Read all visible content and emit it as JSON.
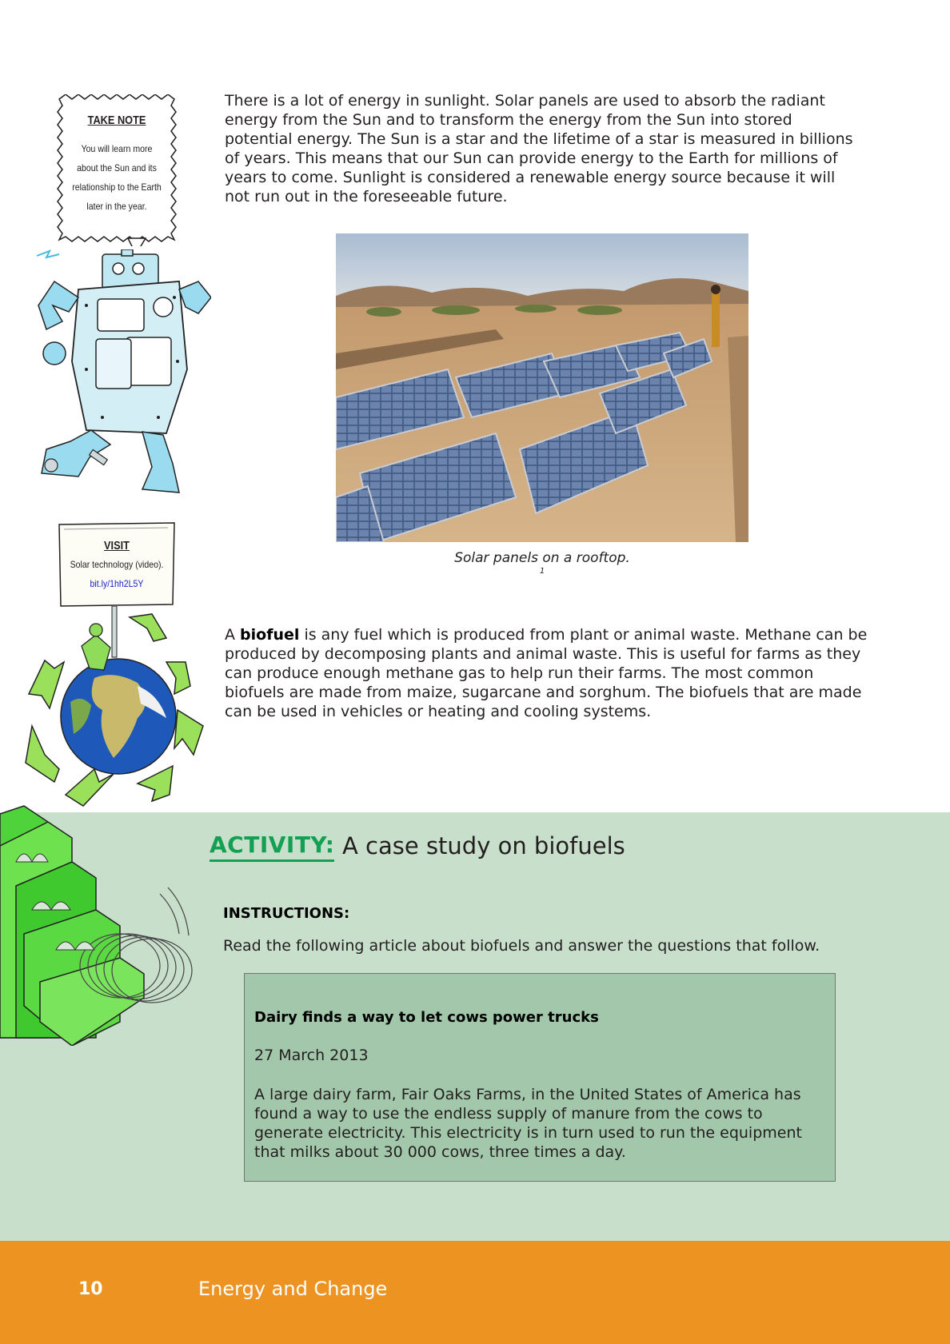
{
  "paragraphs": {
    "solar": "There is a lot of energy in sunlight. Solar panels are used to absorb the radiant energy from the Sun and to transform the energy from the Sun into stored potential energy. The Sun is a star and the lifetime of a star is measured in billions of years. This means that our Sun can provide energy to the Earth for millions of years to come. Sunlight is considered a renewable energy source because it will not run out in the foreseeable future.",
    "biofuel_a": "A ",
    "biofuel_term": "biofuel",
    "biofuel_rest": " is any fuel which is produced from plant or animal waste. Methane can be produced by decomposing plants and animal waste. This is useful for farms as they can produce enough methane gas to help run their farms. The most common biofuels are made from maize, sugarcane and sorghum. The biofuels that are made can be used in vehicles or heating and cooling systems."
  },
  "take_note": {
    "title": "TAKE NOTE",
    "lines": [
      "You will learn more",
      "about the Sun and its",
      "relationship to the Earth",
      "later in the year."
    ]
  },
  "visit": {
    "title": "VISIT",
    "text": "Solar technology (video).",
    "link": "bit.ly/1hh2L5Y"
  },
  "photo": {
    "caption": "Solar panels on a rooftop.",
    "footnote": "1"
  },
  "activity": {
    "label": "ACTIVITY:",
    "title": "A case study on biofuels",
    "instructions_heading": "INSTRUCTIONS:",
    "instructions_text": "Read the following article about biofuels and answer the questions that follow.",
    "article": {
      "headline": "Dairy finds a way to let cows power trucks",
      "date": "27 March 2013",
      "body": "A large dairy farm, Fair Oaks Farms, in the United States of America has found a way to use the endless supply of manure from the cows to generate electricity. This electricity is in turn used to run the equipment that milks about 30 000 cows, three times a day."
    }
  },
  "footer": {
    "page_number": "10",
    "book_title": "Energy and Change"
  },
  "colors": {
    "activity_bg": "#c8dfcb",
    "activity_green": "#14a052",
    "article_bg": "#a3c7aa",
    "footer_orange": "#ec9322",
    "link_blue": "#1a22c8"
  },
  "icons": [
    "robot-illustration",
    "earth-recycle-illustration",
    "stairs-spring-illustration"
  ]
}
